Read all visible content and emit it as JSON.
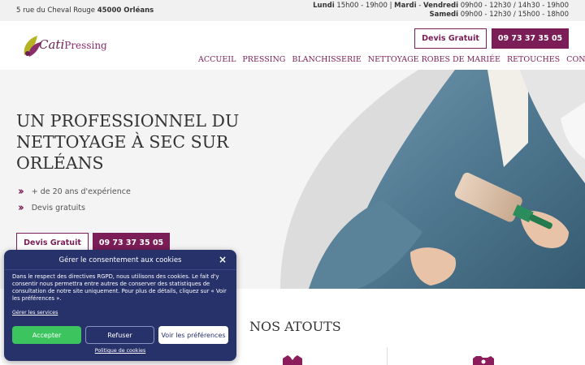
{
  "topbar": {
    "address_street": "5 rue du Cheval Rouge",
    "address_city": "45000 Orléans",
    "hours_line1_day1": "Lundi",
    "hours_line1_time1": " 15h00 - 19h00 | ",
    "hours_line1_day2": "Mardi",
    "hours_line1_sep": " - ",
    "hours_line1_day3": "Vendredi",
    "hours_line1_time2": " 09h00 - 12h30 / 14h30 - 19h00",
    "hours_line2_day": "Samedi",
    "hours_line2_time": " 09h00 - 12h30 / 15h00 - 18h00"
  },
  "header": {
    "logo_text_a": "Cati",
    "logo_text_b": "Pressing",
    "devis_label": "Devis Gratuit",
    "phone_label": "09 73 37 35 05"
  },
  "nav": {
    "items": [
      "ACCUEIL",
      "PRESSING",
      "BLANCHISSERIE",
      "NETTOYAGE ROBES DE MARIÉE",
      "RETOUCHES",
      "CONTACT"
    ]
  },
  "hero": {
    "title": "UN PROFESSIONNEL DU NETTOYAGE À SEC SUR ORLÉANS",
    "features": [
      "+ de 20 ans d'expérience",
      "Devis gratuits"
    ],
    "devis_label": "Devis Gratuit",
    "phone_label": "09 73 37 35 05"
  },
  "atouts": {
    "title": "NOS ATOUTS"
  },
  "cookie": {
    "title": "Gérer le consentement aux cookies",
    "close": "×",
    "text": "Dans le respect des directives RGPD, nous utilisons des cookies. Le fait d'y consentir nous permettra entre autres de conserver des statistiques de consultation de notre site uniquement. Pour plus de détails, cliquez sur « Voir les préférences ».",
    "manage": "Gérer les services",
    "accept": "Accepter",
    "refuse": "Refuser",
    "prefs": "Voir les préférences",
    "policy": "Politique de cookies"
  },
  "colors": {
    "brand": "#7b1d56",
    "cookie_bg": "#27316a",
    "accept_green": "#3cc55f"
  }
}
